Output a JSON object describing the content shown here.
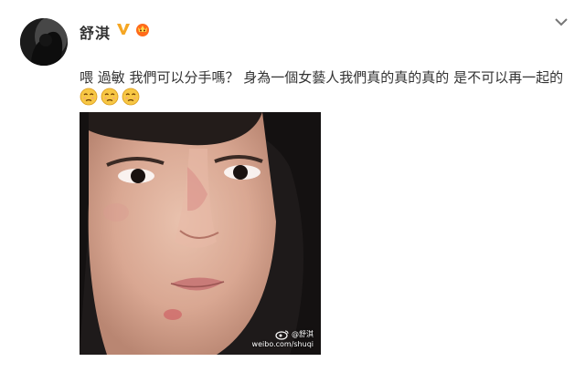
{
  "post": {
    "author": "舒淇",
    "text": "喂 過敏 我們可以分手嗎？ 身為一個女藝人我們真的真的真的 是不可以再一起的",
    "emoji_count": 3,
    "emoji_icon": "sad-face-emoji",
    "verified_icon": "verified-v-badge-icon",
    "member_icon": "member-crown-icon",
    "menu_icon": "chevron-down-icon",
    "photo": {
      "description_icon": "face-photo",
      "watermark_handle": "@舒淇",
      "watermark_url": "weibo.com/shuqi"
    }
  },
  "colors": {
    "verified": "#f5a623",
    "member": "#ff6a1a",
    "emoji": "#f7c744",
    "text": "#333333"
  }
}
